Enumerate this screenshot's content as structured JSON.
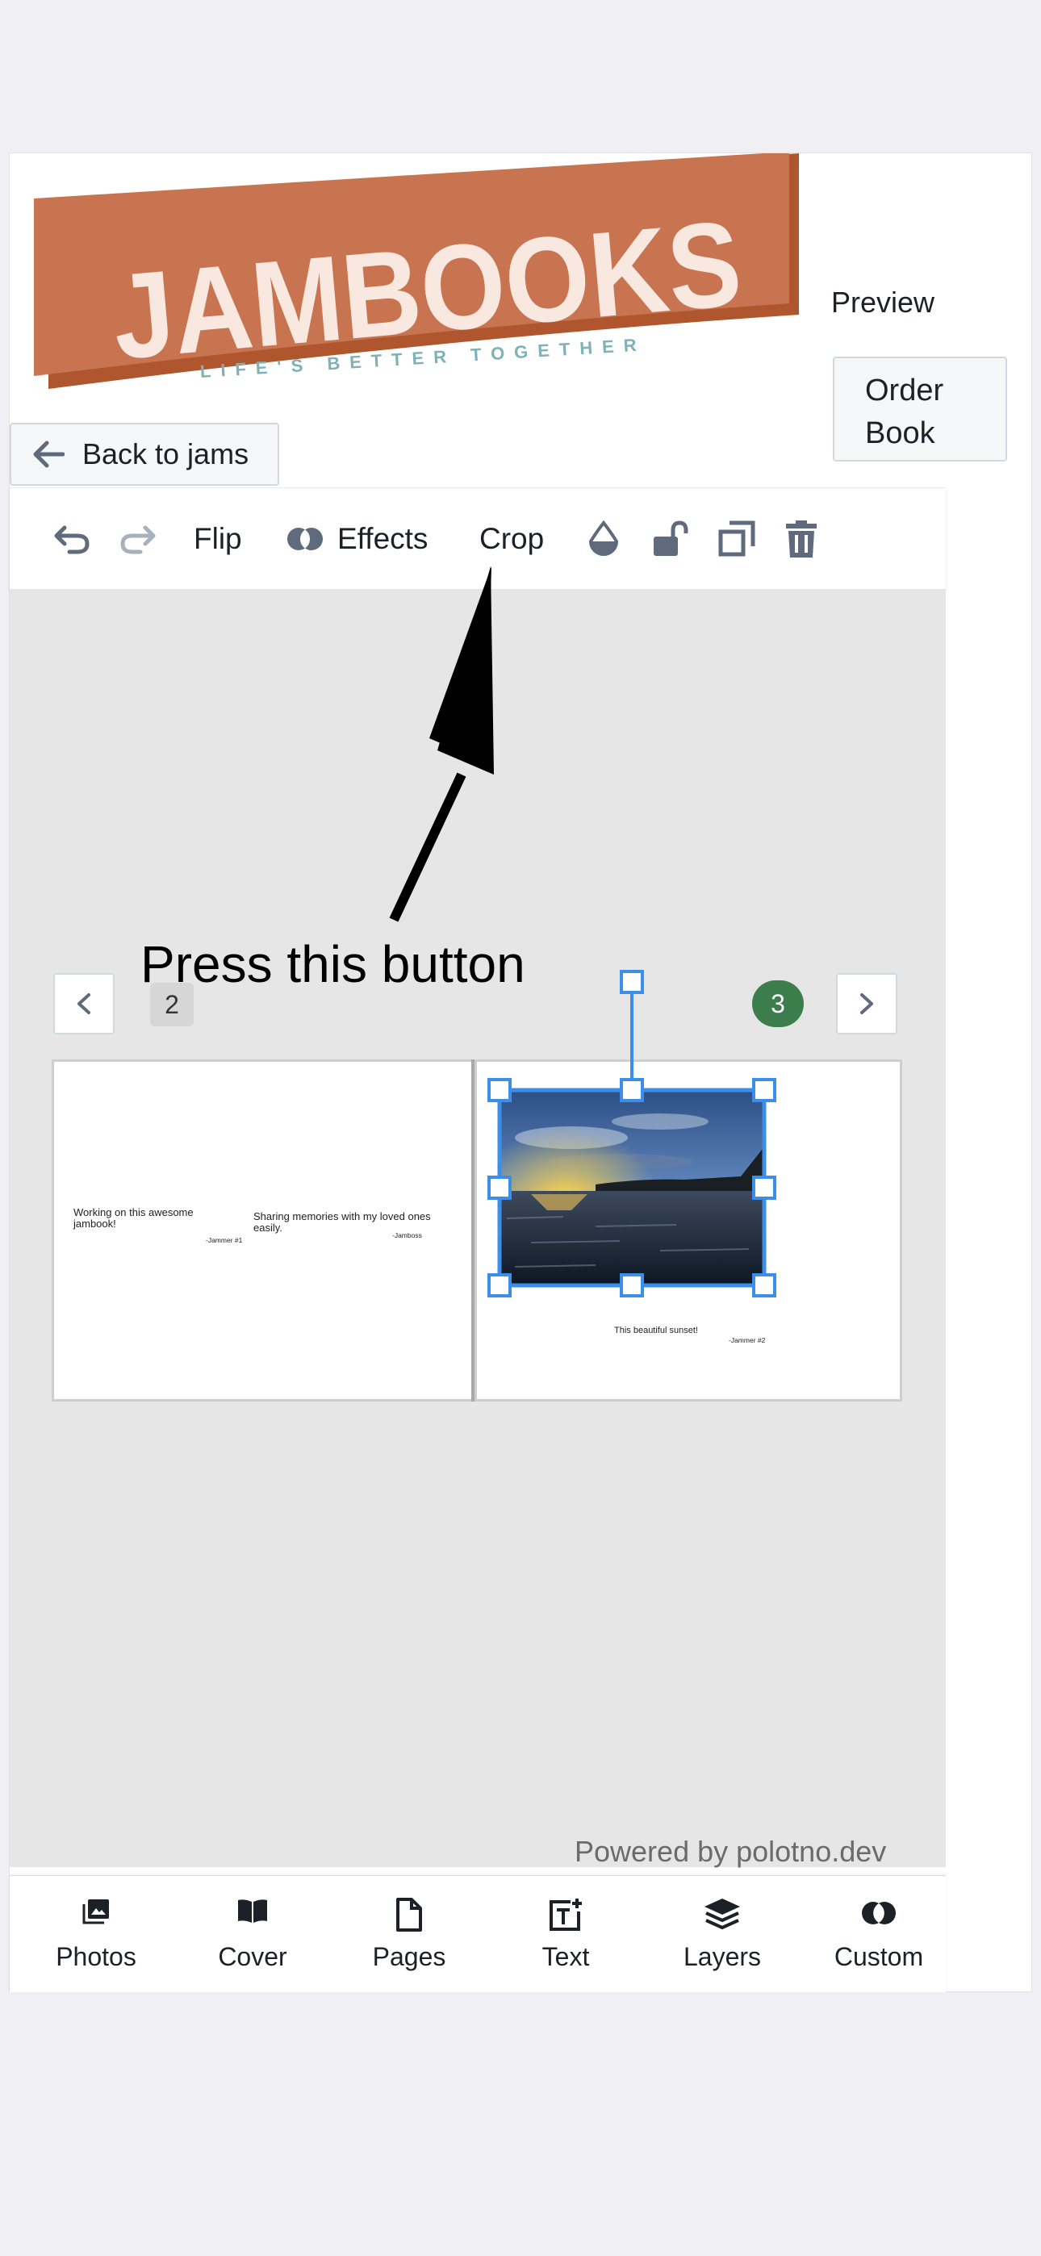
{
  "header": {
    "logo_text": "JAMBOOKS",
    "logo_tagline": "LIFE'S BETTER TOGETHER",
    "preview_label": "Preview",
    "order_button_label": "Order Book",
    "back_button_label": "Back to jams"
  },
  "toolbar": {
    "undo_icon": "undo-icon",
    "redo_icon": "redo-icon",
    "flip_label": "Flip",
    "effects_label": "Effects",
    "crop_label": "Crop",
    "transparency_icon": "transparency-icon",
    "lock_icon": "unlock-icon",
    "duplicate_icon": "duplicate-icon",
    "delete_icon": "trash-icon"
  },
  "annotation": {
    "text": "Press this button"
  },
  "pager": {
    "left_page_number": "2",
    "right_page_number": "3"
  },
  "spread": {
    "left_page": {
      "caption_1": "Working on this awesome jambook!",
      "signature_1": "-Jammer #1",
      "caption_2": "Sharing memories with my loved ones easily.",
      "signature_2": "-Jamboss"
    },
    "right_page": {
      "photo_subject": "sunset over water",
      "caption": "This beautiful sunset!",
      "signature": "-Jammer #2"
    }
  },
  "footer": {
    "powered_by": "Powered by polotno.dev"
  },
  "bottom_tabs": [
    {
      "label": "Photos",
      "icon": "photos-icon"
    },
    {
      "label": "Cover",
      "icon": "book-icon"
    },
    {
      "label": "Pages",
      "icon": "page-icon"
    },
    {
      "label": "Text",
      "icon": "text-icon"
    },
    {
      "label": "Layers",
      "icon": "layers-icon"
    },
    {
      "label": "Custom",
      "icon": "custom-icon"
    }
  ],
  "colors": {
    "logo_banner": "#c87450",
    "logo_banner_shadow": "#b0562f",
    "tagline": "#7fb1b6",
    "selection": "#3b8fe8",
    "active_page_badge": "#3c7d4c"
  }
}
